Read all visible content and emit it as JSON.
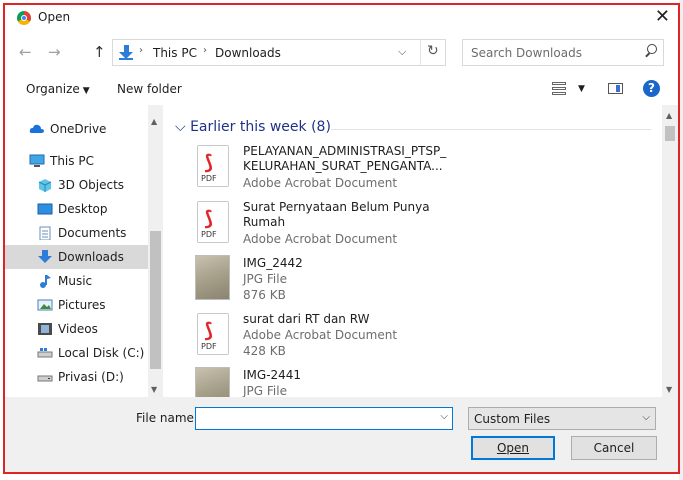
{
  "window": {
    "title": "Open",
    "close_glyph": "✕"
  },
  "nav": {
    "back_glyph": "←",
    "forward_glyph": "→",
    "up_glyph": "↑"
  },
  "address": {
    "sep1": "›",
    "crumb1": "This PC",
    "sep2": "›",
    "crumb2": "Downloads",
    "dropdown_glyph": "⌵",
    "refresh_glyph": "↻"
  },
  "search": {
    "placeholder": "Search Downloads"
  },
  "toolbar": {
    "organize": "Organize",
    "organize_caret": "▼",
    "new_folder": "New folder",
    "view_caret": "▼",
    "help": "?"
  },
  "sidebar": {
    "items": [
      {
        "label": "OneDrive",
        "icon": "cloud-icon"
      },
      {
        "label": "This PC",
        "icon": "computer-icon"
      },
      {
        "label": "3D Objects",
        "icon": "cube-icon"
      },
      {
        "label": "Desktop",
        "icon": "desktop-icon"
      },
      {
        "label": "Documents",
        "icon": "document-icon"
      },
      {
        "label": "Downloads",
        "icon": "download-icon",
        "selected": true
      },
      {
        "label": "Music",
        "icon": "music-icon"
      },
      {
        "label": "Pictures",
        "icon": "pictures-icon"
      },
      {
        "label": "Videos",
        "icon": "videos-icon"
      },
      {
        "label": "Local Disk (C:)",
        "icon": "drive-icon"
      },
      {
        "label": "Privasi (D:)",
        "icon": "drive-icon"
      }
    ],
    "scroll_up": "▲",
    "scroll_down": "▼"
  },
  "files": {
    "group_header": "Earlier this week (8)",
    "group_caret": "⌵",
    "items": [
      {
        "name1": "PELAYANAN_ADMINISTRASI_PTSP_",
        "name2": "KELURAHAN_SURAT_PENGANTA...",
        "type": "Adobe Acrobat Document",
        "icon": "pdf-icon"
      },
      {
        "name1": "Surat Pernyataan Belum Punya",
        "name2": "Rumah",
        "type": "Adobe Acrobat Document",
        "icon": "pdf-icon"
      },
      {
        "name1": "IMG_2442",
        "type": "JPG File",
        "size": "876 KB",
        "icon": "image-thumbnail"
      },
      {
        "name1": "surat dari RT dan RW",
        "type": "Adobe Acrobat Document",
        "size": "428 KB",
        "icon": "pdf-icon"
      },
      {
        "name1": "IMG-2441",
        "type": "JPG File",
        "icon": "image-thumbnail"
      }
    ],
    "pdf_label": "PDF",
    "scroll_up": "▲",
    "scroll_down": "▼"
  },
  "footer": {
    "filename_label": "File name:",
    "filename_value": "",
    "dropdown_glyph": "⌵",
    "filter_value": "Custom Files",
    "open_label": "Open",
    "cancel_label": "Cancel"
  },
  "colors": {
    "accent": "#0078d7",
    "dialog_border": "#e02424",
    "group_header": "#1e3287",
    "pdf_red": "#e0282b"
  }
}
